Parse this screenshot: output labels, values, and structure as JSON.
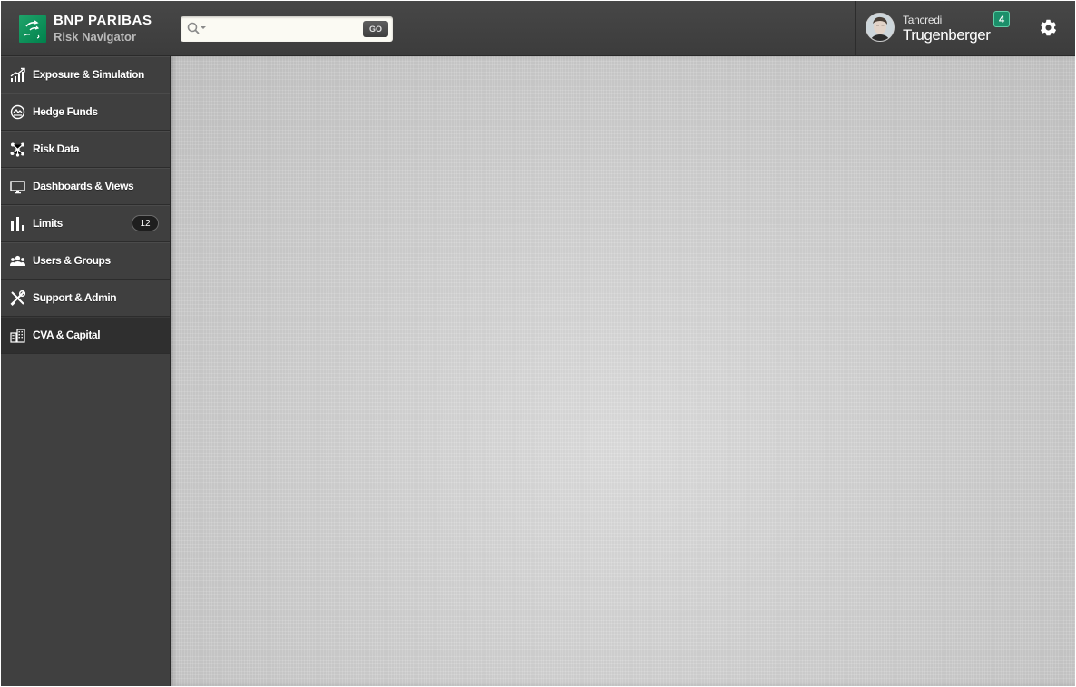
{
  "header": {
    "brand": "BNP PARIBAS",
    "app_name": "Risk Navigator",
    "search": {
      "value": "",
      "placeholder": "",
      "go_label": "GO"
    },
    "user": {
      "first_name": "Tancredi",
      "last_name": "Trugenberger",
      "notifications": "4"
    }
  },
  "sidebar": {
    "items": [
      {
        "label": "Exposure & Simulation",
        "icon": "exposure-chart-icon"
      },
      {
        "label": "Hedge Funds",
        "icon": "hedge-funds-icon"
      },
      {
        "label": "Risk Data",
        "icon": "risk-data-icon"
      },
      {
        "label": "Dashboards & Views",
        "icon": "monitor-icon"
      },
      {
        "label": "Limits",
        "icon": "bar-chart-icon",
        "badge": "12"
      },
      {
        "label": "Users & Groups",
        "icon": "users-icon"
      },
      {
        "label": "Support & Admin",
        "icon": "tools-icon"
      },
      {
        "label": "CVA & Capital",
        "icon": "buildings-icon",
        "active": true
      }
    ]
  },
  "colors": {
    "brand_green": "#00814c",
    "badge_green": "#1b8f6a",
    "sidebar_bg": "#404040",
    "header_bg": "#474747"
  }
}
